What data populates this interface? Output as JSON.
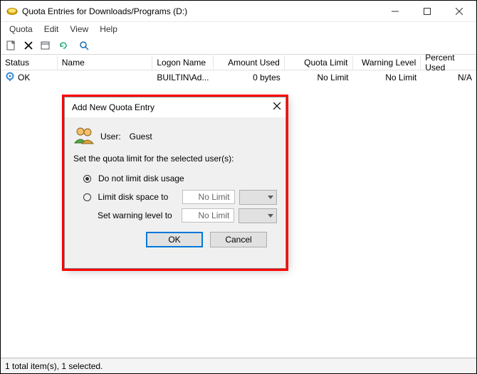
{
  "window": {
    "title": "Quota Entries for Downloads/Programs (D:)"
  },
  "menu": {
    "items": [
      "Quota",
      "Edit",
      "View",
      "Help"
    ]
  },
  "columns": {
    "status": "Status",
    "name": "Name",
    "logon": "Logon Name",
    "amount": "Amount Used",
    "quota": "Quota Limit",
    "warn": "Warning Level",
    "percent": "Percent Used"
  },
  "rows": [
    {
      "status": "OK",
      "name": "",
      "logon": "BUILTIN\\Ad...",
      "amount": "0 bytes",
      "quota": "No Limit",
      "warn": "No Limit",
      "percent": "N/A"
    }
  ],
  "statusbar": "1 total item(s), 1 selected.",
  "dialog": {
    "title": "Add New Quota Entry",
    "user_label": "User:",
    "user_value": "Guest",
    "prompt": "Set the quota limit for the selected user(s):",
    "option_no_limit": "Do not limit disk usage",
    "option_limit": "Limit disk space to",
    "warn_label": "Set warning level to",
    "limit_value": "No Limit",
    "warn_value": "No Limit",
    "ok": "OK",
    "cancel": "Cancel",
    "selected_option": "no_limit"
  }
}
